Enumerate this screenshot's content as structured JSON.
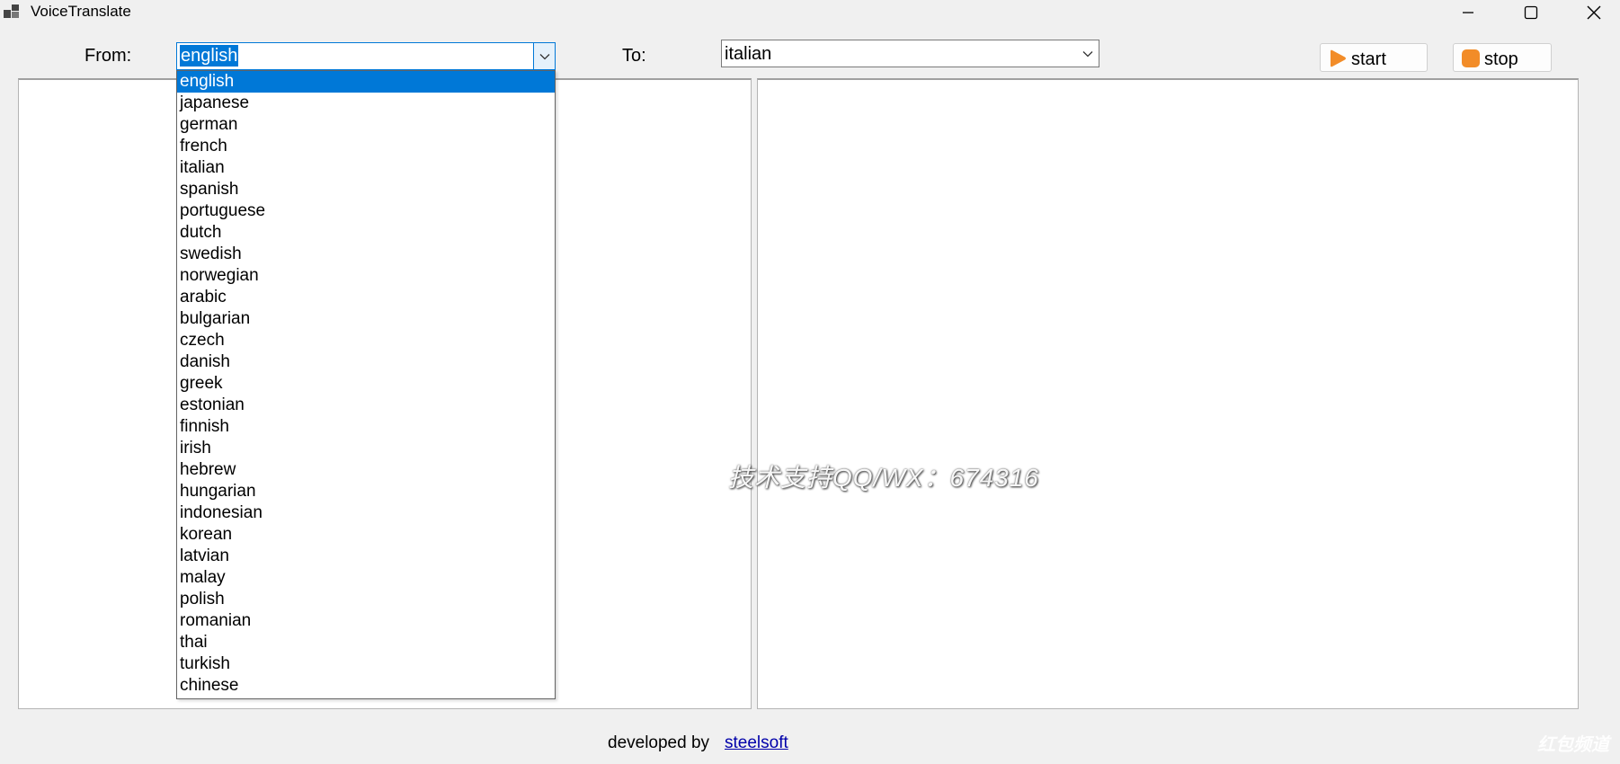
{
  "window": {
    "title": "VoiceTranslate",
    "app_icon": "window-tiles-icon",
    "controls": [
      "minimize-icon",
      "maximize-icon",
      "close-icon"
    ]
  },
  "labels": {
    "from": "From:",
    "to": "To:"
  },
  "from_combo": {
    "value": "english",
    "expanded": true,
    "options": [
      "english",
      "japanese",
      "german",
      "french",
      "italian",
      "spanish",
      "portuguese",
      "dutch",
      "swedish",
      "norwegian",
      "arabic",
      "bulgarian",
      "czech",
      "danish",
      "greek",
      "estonian",
      "finnish",
      "irish",
      "hebrew",
      "hungarian",
      "indonesian",
      "korean",
      "latvian",
      "malay",
      "polish",
      "romanian",
      "thai",
      "turkish",
      "chinese"
    ]
  },
  "to_combo": {
    "value": "italian"
  },
  "buttons": {
    "start": "start",
    "stop": "stop"
  },
  "footer": {
    "text": "developed by",
    "link": "steelsoft"
  },
  "watermark": "技术支持QQ/WX：674316",
  "colors": {
    "accent": "#0078d7",
    "start_icon": "#f28c28",
    "stop_icon": "#f28c28",
    "link": "#0000aa"
  }
}
